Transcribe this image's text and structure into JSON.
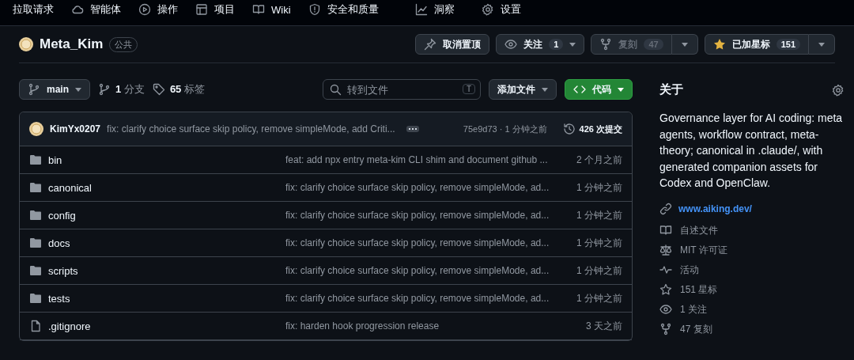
{
  "nav": [
    {
      "label": "拉取请求"
    },
    {
      "label": "智能体"
    },
    {
      "label": "操作"
    },
    {
      "label": "项目"
    },
    {
      "label": "Wiki"
    },
    {
      "label": "安全和质量"
    },
    {
      "label": "洞察"
    },
    {
      "label": "设置"
    }
  ],
  "repo": {
    "name": "Meta_Kim",
    "visibility": "公共"
  },
  "actions": [
    {
      "kind": "pin",
      "label": "取消置顶",
      "disabled": false
    },
    {
      "kind": "watch",
      "label": "关注",
      "count": "1",
      "disabled": false
    },
    {
      "kind": "fork",
      "label": "复刻",
      "count": "47",
      "disabled": true
    },
    {
      "kind": "star",
      "label": "已加星标",
      "count": "151",
      "disabled": false,
      "starred": true
    }
  ],
  "toolbar": {
    "branch": "main",
    "branches": "**1** 分支",
    "tags": "**65** 标签",
    "search": {
      "placeholder": "转到文件",
      "shortcut": "T"
    },
    "add_file": "添加文件",
    "code": "代码"
  },
  "commit": {
    "author": "KimYx0207",
    "message": "fix: clarify choice surface skip policy, remove simpleMode, add Criti...",
    "hash_time": "75e9d73 · 1 分钟之前",
    "commits": "426 次提交"
  },
  "files": [
    {
      "kind": "folder",
      "name": "bin",
      "message": "feat: add npx entry meta-kim CLI shim and document github ...",
      "time": "2 个月之前"
    },
    {
      "kind": "folder",
      "name": "canonical",
      "message": "fix: clarify choice surface skip policy, remove simpleMode, ad...",
      "time": "1 分钟之前"
    },
    {
      "kind": "folder",
      "name": "config",
      "message": "fix: clarify choice surface skip policy, remove simpleMode, ad...",
      "time": "1 分钟之前"
    },
    {
      "kind": "folder",
      "name": "docs",
      "message": "fix: clarify choice surface skip policy, remove simpleMode, ad...",
      "time": "1 分钟之前"
    },
    {
      "kind": "folder",
      "name": "scripts",
      "message": "fix: clarify choice surface skip policy, remove simpleMode, ad...",
      "time": "1 分钟之前"
    },
    {
      "kind": "folder",
      "name": "tests",
      "message": "fix: clarify choice surface skip policy, remove simpleMode, ad...",
      "time": "1 分钟之前"
    },
    {
      "kind": "file",
      "name": ".gitignore",
      "message": "fix: harden hook progression release",
      "time": "3 天之前"
    }
  ],
  "about": {
    "title": "关于",
    "description": "Governance layer for AI coding: meta agents, workflow contract, meta-theory; canonical in .claude/, with generated companion assets for Codex and OpenClaw.",
    "link": "www.aiking.dev/",
    "items": [
      {
        "kind": "readme",
        "label": "自述文件"
      },
      {
        "kind": "license",
        "label": "MIT 许可证"
      },
      {
        "kind": "activity",
        "label": "活动"
      },
      {
        "kind": "stars",
        "label": "151 星标"
      },
      {
        "kind": "watchers",
        "label": "1 关注"
      },
      {
        "kind": "forks",
        "label": "47 复刻"
      }
    ]
  }
}
